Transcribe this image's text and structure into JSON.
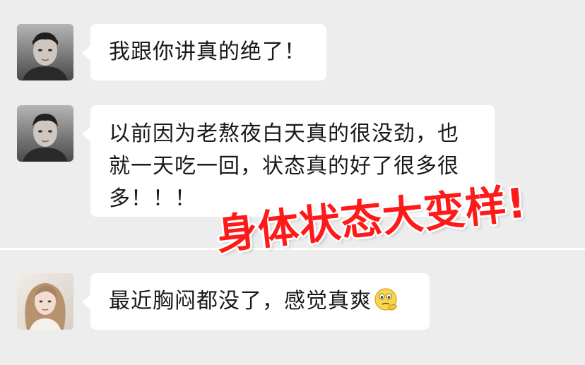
{
  "colors": {
    "background": "#ededed",
    "bubble": "#ffffff",
    "text": "#191919",
    "overlay_text": "#ff1a1a"
  },
  "messages": [
    {
      "sender": "male-avatar",
      "lines": [
        "我跟你讲真的绝了！"
      ]
    },
    {
      "sender": "male-avatar",
      "lines": [
        "以前因为老熬夜白天真的很没劲，也",
        "就一天吃一回，状态真的好了很多很",
        "多！！！"
      ]
    },
    {
      "sender": "female-avatar",
      "lines": [
        "最近胸闷都没了，感觉真爽"
      ],
      "emoji": "thinking-face-icon"
    }
  ],
  "overlay": {
    "text": "身体状态大变样!"
  }
}
